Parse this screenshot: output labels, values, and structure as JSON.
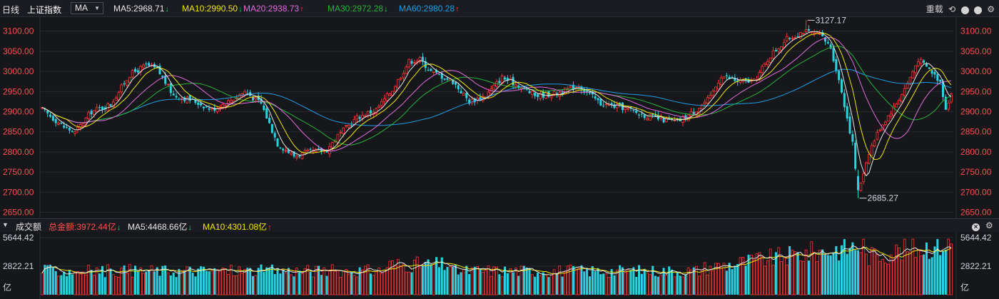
{
  "toolbar": {
    "period": "日线",
    "index_name": "上证指数",
    "ma_select": "MA",
    "ma_values": [
      {
        "label": "MA5:2968.71",
        "dir": "down",
        "color": "#e6e6e6"
      },
      {
        "label": "MA10:2990.50",
        "dir": "down",
        "color": "#f2e600"
      },
      {
        "label": "MA20:2938.73",
        "dir": "up",
        "color": "#e36ce0"
      },
      {
        "label": "MA30:2972.28",
        "dir": "down",
        "color": "#27b33b"
      },
      {
        "label": "MA60:2980.28",
        "dir": "up",
        "color": "#1e9ee6"
      }
    ],
    "reload_label": "重载",
    "arrow_up": "↑",
    "arrow_down": "↓"
  },
  "price_chart": {
    "y_ticks": [
      "3100.00",
      "3050.00",
      "3000.00",
      "2950.00",
      "2900.00",
      "2850.00",
      "2800.00",
      "2750.00",
      "2700.00",
      "2650.00"
    ],
    "ymin": 2635,
    "ymax": 3135,
    "high_label": "3127.17",
    "low_label": "2685.27",
    "colors": {
      "up": "#ff3333",
      "down": "#2ad3e2",
      "grid": "#26282e",
      "axis_text": "#ff4d4d"
    }
  },
  "volume_panel": {
    "title": "成交额",
    "total": "总金额:3972.44亿",
    "total_dir": "down",
    "ma5": "MA5:4468.66亿",
    "ma5_dir": "down",
    "ma10": "MA10:4301.08亿",
    "ma10_dir": "up",
    "y_ticks": [
      "5644.42",
      "2822.21"
    ],
    "unit": "亿",
    "ymax": 5644.42
  }
}
